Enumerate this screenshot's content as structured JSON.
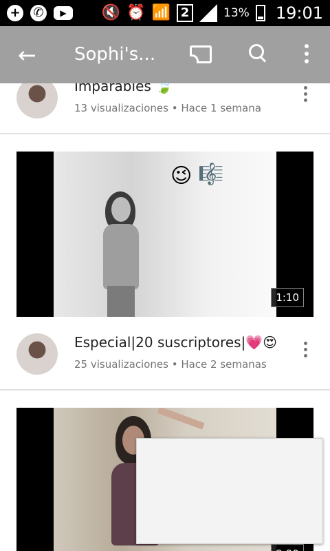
{
  "status_bar": {
    "battery_percent": "13%",
    "sim_number": "2",
    "time": "19:01",
    "icons": [
      "plus-icon",
      "whatsapp-icon",
      "youtube-icon",
      "mute-icon",
      "alarm-icon",
      "wifi-icon",
      "sim-icon",
      "signal-icon",
      "battery-icon"
    ]
  },
  "app_bar": {
    "title": "Sophi's...",
    "back_icon": "arrow-left-icon",
    "cast_icon": "cast-icon",
    "search_icon": "search-icon",
    "more_icon": "more-vert-icon"
  },
  "videos": [
    {
      "title": "Imparables 🍃",
      "meta": "13 visualizaciones • Hace 1 semana"
    },
    {
      "duration": "1:10",
      "title": "Especial|20 suscriptores|💗😍",
      "meta": "25 visualizaciones • Hace 2 semanas"
    },
    {
      "duration": "2:29"
    }
  ],
  "thumbnail_emojis": [
    "😉",
    "🎼"
  ],
  "colors": {
    "app_bar": "#a0a0a0",
    "status_bar": "#000000",
    "meta_text": "#757575"
  }
}
